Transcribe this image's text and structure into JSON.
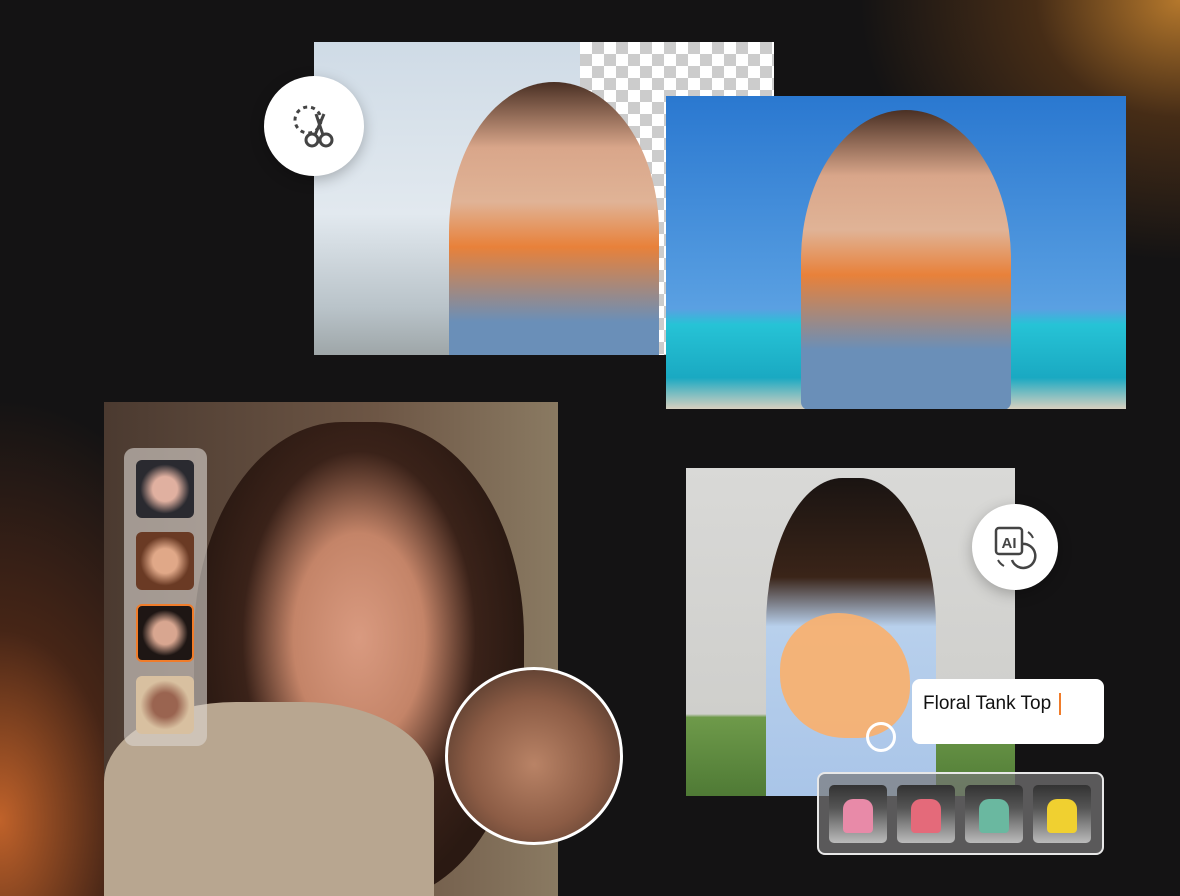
{
  "tools": {
    "cutout_icon": "scissors-dashed-circle-icon",
    "ai_icon": "ai-swap-icon",
    "ai_icon_text": "AI"
  },
  "clothing_prompt": {
    "value": "Floral Tank Top",
    "cursor_color": "#f07c2a"
  },
  "face_thumbnails": {
    "count": 4,
    "selected_index": 2,
    "selected_color": "#f07c2a"
  },
  "clothing_thumbnails": {
    "count": 4,
    "colors": [
      "#e88aa8",
      "#e46a7a",
      "#6ab8a0",
      "#f0d030"
    ]
  },
  "colors": {
    "background": "#141314",
    "accent": "#f07c2a",
    "blob": "#f7b172"
  }
}
